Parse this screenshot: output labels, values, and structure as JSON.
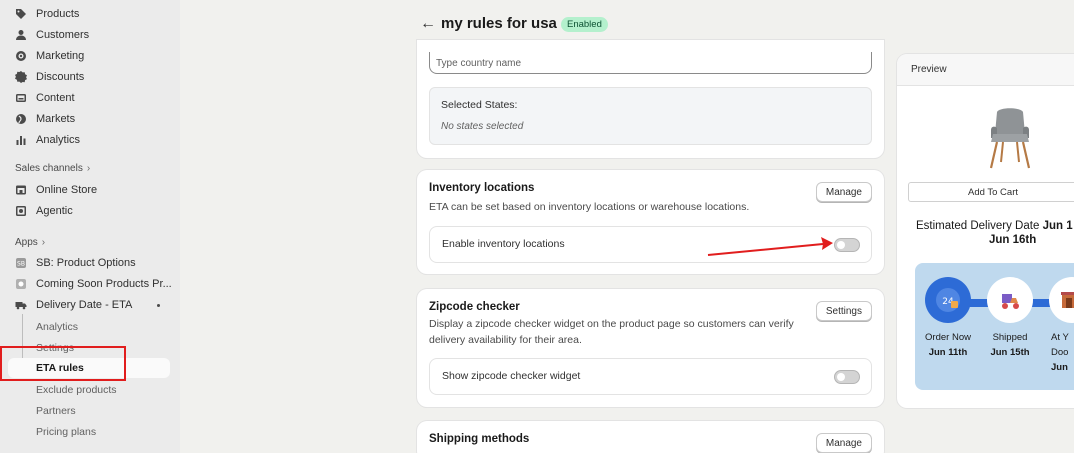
{
  "sidebar": {
    "main_items": [
      {
        "label": "Products",
        "icon": "tag-icon"
      },
      {
        "label": "Customers",
        "icon": "person-icon"
      },
      {
        "label": "Marketing",
        "icon": "target-icon"
      },
      {
        "label": "Discounts",
        "icon": "discount-icon"
      },
      {
        "label": "Content",
        "icon": "image-icon"
      },
      {
        "label": "Markets",
        "icon": "globe-icon"
      },
      {
        "label": "Analytics",
        "icon": "bar-chart-icon"
      }
    ],
    "sales_channels_label": "Sales channels",
    "channels": [
      {
        "label": "Online Store",
        "icon": "store-icon"
      },
      {
        "label": "Agentic",
        "icon": "agent-icon"
      }
    ],
    "apps_label": "Apps",
    "apps": [
      {
        "label": "SB: Product Options",
        "icon": "app-icon"
      },
      {
        "label": "Coming Soon Products Pr...",
        "icon": "app-icon"
      },
      {
        "label": "Delivery Date - ETA",
        "icon": "truck-icon"
      }
    ],
    "sub_items": [
      "Analytics",
      "Settings",
      "ETA rules",
      "Exclude products",
      "Partners",
      "Pricing plans"
    ]
  },
  "header": {
    "title": "my rules for usa",
    "badge": "Enabled"
  },
  "country_card": {
    "placeholder": "Type country name",
    "selected_states_label": "Selected States:",
    "selected_states_value": "No states selected"
  },
  "inventory_card": {
    "title": "Inventory locations",
    "description": "ETA can be set based on inventory locations or warehouse locations.",
    "button": "Manage",
    "toggle_label": "Enable inventory locations",
    "toggle_on": false
  },
  "zipcode_card": {
    "title": "Zipcode checker",
    "description": "Display a zipcode checker widget on the product page so customers can verify delivery availability for their area.",
    "button": "Settings",
    "toggle_label": "Show zipcode checker widget",
    "toggle_on": false
  },
  "shipping_card": {
    "title": "Shipping methods",
    "button": "Manage"
  },
  "preview": {
    "title": "Preview",
    "add_to_cart": "Add To Cart",
    "eta_prefix": "Estimated Delivery Date",
    "eta_start": "Jun 1",
    "eta_end": "Jun 16th",
    "steps": [
      {
        "label": "Order Now",
        "date": "Jun 11th"
      },
      {
        "label": "Shipped",
        "date": "Jun 15th"
      },
      {
        "label": "At Y",
        "label2": "Doo",
        "date": "Jun"
      }
    ]
  },
  "colors": {
    "highlight_box": "#e11d1d",
    "timeline_bg": "#bfd9ee",
    "timeline_accent": "#2d6bd6",
    "badge_bg": "#b4f0cd"
  }
}
